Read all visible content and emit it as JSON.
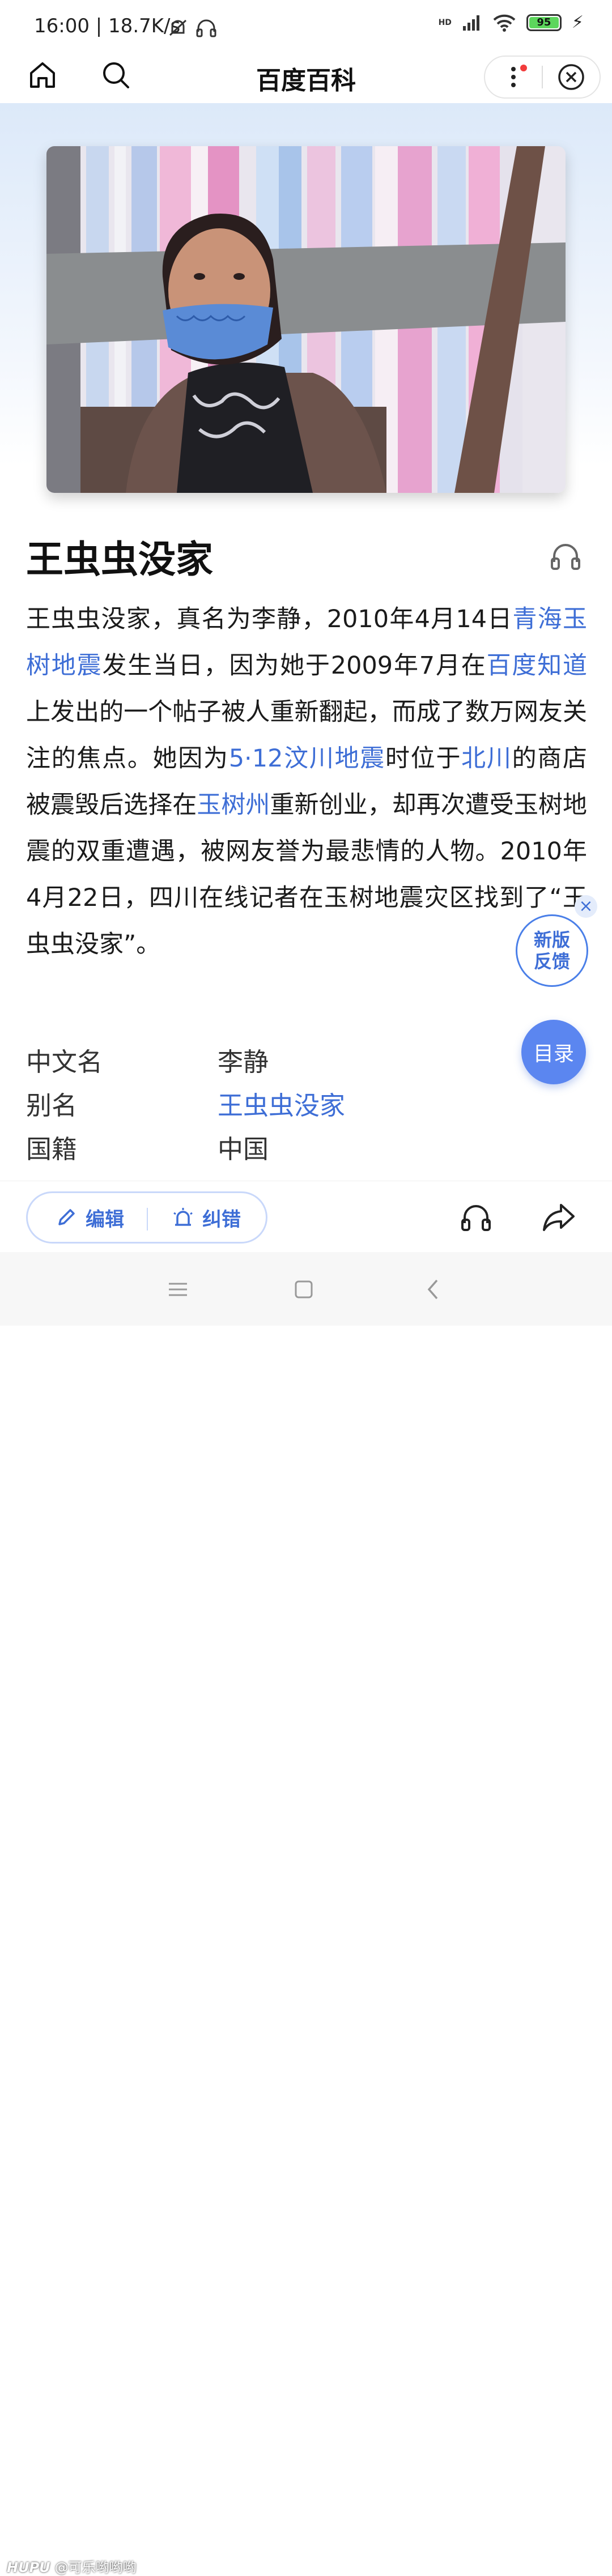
{
  "status": {
    "time_speed": "16:00 | 18.7K/s",
    "network": "HD",
    "battery": "95"
  },
  "nav": {
    "title": "百度百科"
  },
  "entry": {
    "title": "王虫虫没家",
    "summary": {
      "p1": "王虫虫没家，真名为李静，2010年4月14日",
      "link1": "青海玉树地震",
      "p2": "发生当日，因为她于2009年7月在",
      "link2": "百度知道",
      "p3": "上发出的一个帖子被人重新翻起，而成了数万网友关注的焦点。她因为",
      "link3": "5·12汶川地震",
      "p4": "时位于",
      "link4": "北川",
      "p5": "的商店被震毁后选择在",
      "link5": "玉树州",
      "p6": "重新创业，却再次遭受玉树地震的双重遭遇，被网友誉为最悲情的人物。2010年4月22日，四川在线记者在玉树地震灾区找到了“王虫虫没家”。"
    },
    "info": [
      {
        "label": "中文名",
        "value": "李静"
      },
      {
        "label": "别名",
        "value": "王虫虫没家"
      },
      {
        "label": "国籍",
        "value": "中国"
      }
    ]
  },
  "float": {
    "feedback_line1": "新版",
    "feedback_line2": "反馈",
    "feedback_close": "×",
    "toc": "目录"
  },
  "toolbar": {
    "edit": "编辑",
    "correct": "纠错"
  },
  "watermark": {
    "brand": "HUPU",
    "user": "@可乐哟哟哟"
  }
}
